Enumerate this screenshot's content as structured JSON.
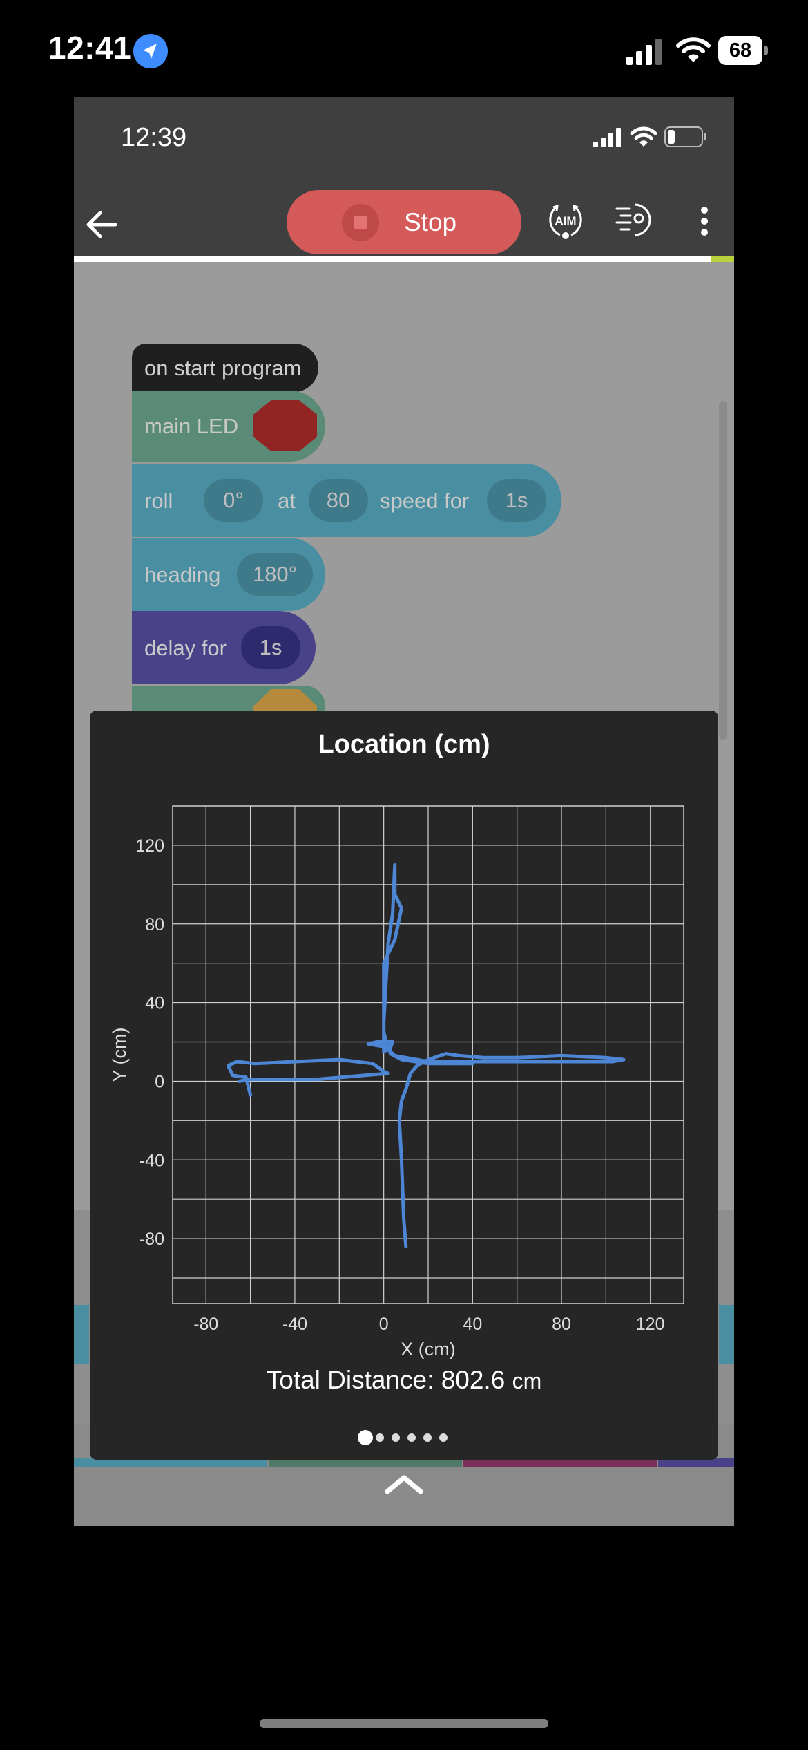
{
  "status_bar": {
    "time": "12:41",
    "battery": "68"
  },
  "app": {
    "status_time": "12:39",
    "toolbar": {
      "stop_label": "Stop",
      "aim_label": "AIM"
    }
  },
  "blocks": {
    "start": "on start program",
    "led": "main LED",
    "roll": {
      "label": "roll",
      "angle": "0°",
      "at_label": "at",
      "speed": "80",
      "speed_label": "speed for",
      "duration": "1s"
    },
    "heading": {
      "label": "heading",
      "value": "180°"
    },
    "delay": {
      "label": "delay for",
      "value": "1s"
    }
  },
  "popup": {
    "title": "Location (cm)",
    "total_distance_label": "Total Distance:",
    "total_distance_value": "802.6",
    "total_distance_unit": "cm",
    "page_count": 6,
    "active_page": 0
  },
  "chart_data": {
    "type": "line",
    "xlabel": "X (cm)",
    "ylabel": "Y (cm)",
    "xlim": [
      -95,
      135
    ],
    "ylim": [
      -113,
      140
    ],
    "xticks": [
      -80,
      -40,
      0,
      40,
      80,
      120
    ],
    "yticks": [
      120,
      80,
      40,
      0,
      -40,
      -80
    ],
    "grid": true,
    "color": "#4e86d6",
    "series": [
      {
        "points": [
          [
            -60,
            -7
          ],
          [
            -62,
            2
          ],
          [
            -68,
            3
          ],
          [
            -70,
            8
          ],
          [
            -66,
            10
          ],
          [
            -58,
            9
          ],
          [
            -40,
            10
          ],
          [
            -20,
            11
          ],
          [
            -5,
            9
          ],
          [
            0,
            5
          ],
          [
            2,
            4
          ],
          [
            -30,
            1
          ],
          [
            -60,
            1
          ],
          [
            -65,
            0
          ]
        ]
      },
      {
        "points": [
          [
            10,
            -84
          ],
          [
            9,
            -70
          ],
          [
            8,
            -40
          ],
          [
            7,
            -20
          ],
          [
            8,
            -10
          ],
          [
            10,
            -4
          ],
          [
            12,
            4
          ],
          [
            15,
            8
          ],
          [
            20,
            11
          ],
          [
            28,
            14
          ],
          [
            34,
            13
          ],
          [
            45,
            12
          ],
          [
            60,
            12
          ],
          [
            80,
            13
          ],
          [
            100,
            12
          ],
          [
            108,
            11
          ],
          [
            103,
            10
          ],
          [
            80,
            10
          ],
          [
            50,
            10
          ],
          [
            20,
            10
          ],
          [
            5,
            13
          ],
          [
            2,
            16
          ],
          [
            0,
            25
          ],
          [
            0,
            40
          ],
          [
            0,
            60
          ],
          [
            5,
            72
          ],
          [
            8,
            88
          ],
          [
            5,
            95
          ],
          [
            5,
            110
          ],
          [
            4,
            85
          ],
          [
            2,
            70
          ],
          [
            1,
            50
          ],
          [
            0,
            30
          ],
          [
            0,
            15
          ],
          [
            3,
            17
          ],
          [
            4,
            20
          ],
          [
            -3,
            20
          ],
          [
            -7,
            19
          ],
          [
            3,
            17
          ],
          [
            3,
            14
          ],
          [
            8,
            11
          ],
          [
            20,
            9
          ],
          [
            40,
            9
          ]
        ]
      }
    ]
  }
}
